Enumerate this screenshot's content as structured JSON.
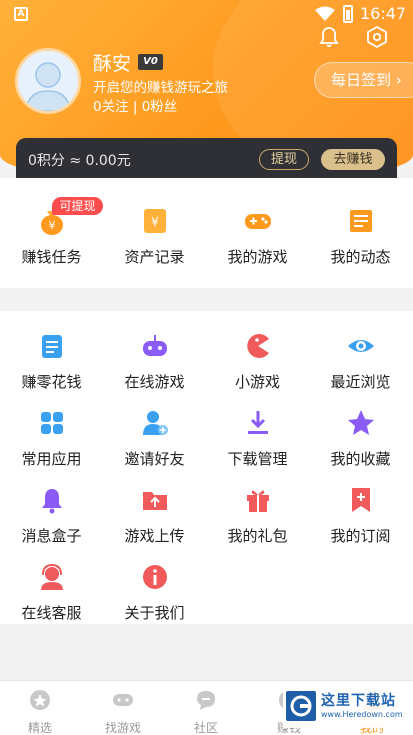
{
  "status": {
    "app_badge": "A",
    "time": "16:47"
  },
  "profile": {
    "name": "酥安",
    "vip_label": "V0",
    "tagline": "开启您的赚钱游玩之旅",
    "follow": "0关注 | 0粉丝",
    "checkin_label": "每日签到"
  },
  "points": {
    "text": "0积分 ≈ 0.00元",
    "withdraw_label": "提现",
    "earn_label": "去赚钱"
  },
  "quick_items": [
    {
      "label": "赚钱任务",
      "icon": "money-bag-icon",
      "tag": "可提现"
    },
    {
      "label": "资产记录",
      "icon": "asset-record-icon"
    },
    {
      "label": "我的游戏",
      "icon": "gamepad-icon"
    },
    {
      "label": "我的动态",
      "icon": "news-icon"
    }
  ],
  "menu_items": [
    {
      "label": "赚零花钱",
      "icon": "task-list-icon"
    },
    {
      "label": "在线游戏",
      "icon": "online-game-icon"
    },
    {
      "label": "小游戏",
      "icon": "pacman-icon"
    },
    {
      "label": "最近浏览",
      "icon": "eye-icon"
    },
    {
      "label": "常用应用",
      "icon": "apps-icon"
    },
    {
      "label": "邀请好友",
      "icon": "invite-friend-icon"
    },
    {
      "label": "下载管理",
      "icon": "download-icon"
    },
    {
      "label": "我的收藏",
      "icon": "star-icon"
    },
    {
      "label": "消息盒子",
      "icon": "bell-icon"
    },
    {
      "label": "游戏上传",
      "icon": "folder-upload-icon"
    },
    {
      "label": "我的礼包",
      "icon": "gift-icon"
    },
    {
      "label": "我的订阅",
      "icon": "bookmark-icon"
    },
    {
      "label": "在线客服",
      "icon": "customer-service-icon"
    },
    {
      "label": "关于我们",
      "icon": "info-icon"
    }
  ],
  "tabs": [
    {
      "label": "精选",
      "icon": "star-tab-icon"
    },
    {
      "label": "找游戏",
      "icon": "gamepad-tab-icon"
    },
    {
      "label": "社区",
      "icon": "chat-tab-icon"
    },
    {
      "label": "赚钱",
      "icon": "coin-tab-icon"
    },
    {
      "label": "我的",
      "icon": "user-tab-icon"
    }
  ],
  "watermark": {
    "title": "这里下载站",
    "url": "www.Heredown.com"
  },
  "colors": {
    "accent": "#ff9a1f",
    "dark_bar": "#2f3036",
    "gold": "#d9c08c",
    "tag_red": "#ff4d4d",
    "icon_blue": "#3aa0f2",
    "icon_purple": "#8a5cf5",
    "icon_red": "#f05a5a",
    "icon_orange": "#ff9a1f"
  }
}
